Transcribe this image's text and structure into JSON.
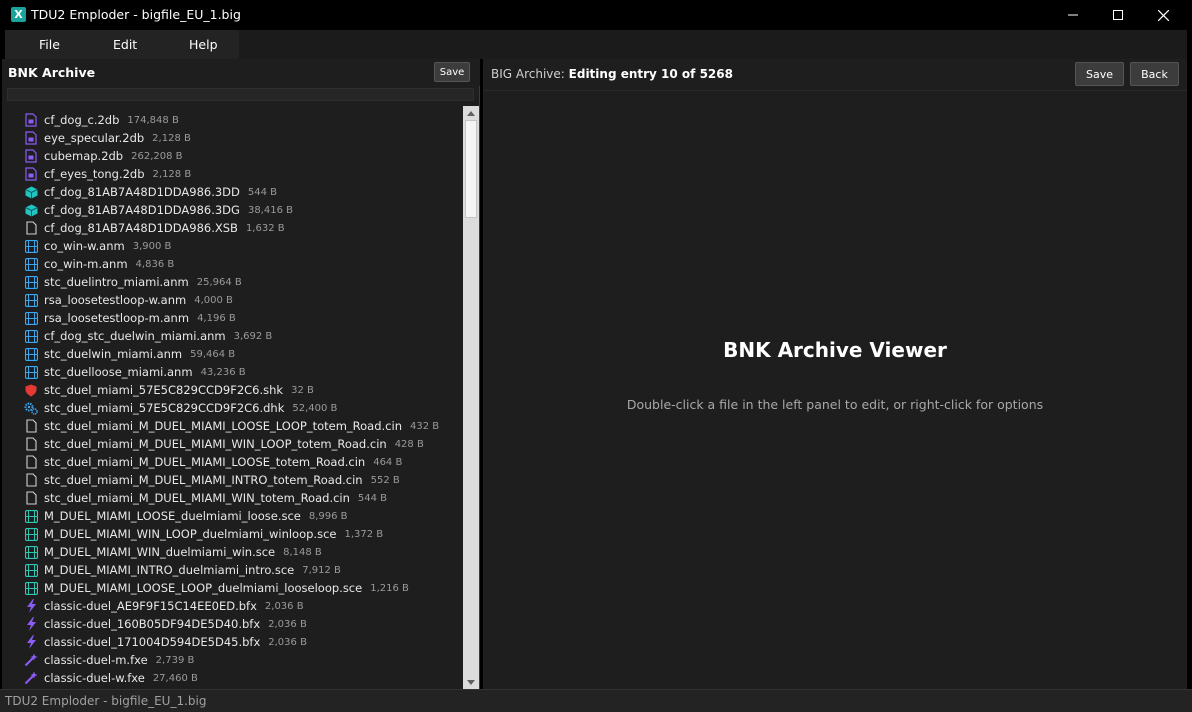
{
  "window": {
    "title": "TDU2 Emploder - bigfile_EU_1.big",
    "app_icon_letter": "X"
  },
  "menu": [
    "File",
    "Edit",
    "Help"
  ],
  "left_panel": {
    "title": "BNK Archive",
    "save_label": "Save",
    "items": [
      {
        "name": "cf_dog_c.2db",
        "size": "174,848 B",
        "icon": "file-2db-icon"
      },
      {
        "name": "eye_specular.2db",
        "size": "2,128 B",
        "icon": "file-2db-icon"
      },
      {
        "name": "cubemap.2db",
        "size": "262,208 B",
        "icon": "file-2db-icon"
      },
      {
        "name": "cf_eyes_tong.2db",
        "size": "2,128 B",
        "icon": "file-2db-icon"
      },
      {
        "name": "cf_dog_81AB7A48D1DDA986.3DD",
        "size": "544 B",
        "icon": "cube-icon"
      },
      {
        "name": "cf_dog_81AB7A48D1DDA986.3DG",
        "size": "38,416 B",
        "icon": "cube-icon"
      },
      {
        "name": "cf_dog_81AB7A48D1DDA986.XSB",
        "size": "1,632 B",
        "icon": "blank-file-icon"
      },
      {
        "name": "co_win-w.anm",
        "size": "3,900 B",
        "icon": "film-icon"
      },
      {
        "name": "co_win-m.anm",
        "size": "4,836 B",
        "icon": "film-icon"
      },
      {
        "name": "stc_duelintro_miami.anm",
        "size": "25,964 B",
        "icon": "film-icon"
      },
      {
        "name": "rsa_loosetestloop-w.anm",
        "size": "4,000 B",
        "icon": "film-icon"
      },
      {
        "name": "rsa_loosetestloop-m.anm",
        "size": "4,196 B",
        "icon": "film-icon"
      },
      {
        "name": "cf_dog_stc_duelwin_miami.anm",
        "size": "3,692 B",
        "icon": "film-icon"
      },
      {
        "name": "stc_duelwin_miami.anm",
        "size": "59,464 B",
        "icon": "film-icon"
      },
      {
        "name": "stc_duelloose_miami.anm",
        "size": "43,236 B",
        "icon": "film-icon"
      },
      {
        "name": "stc_duel_miami_57E5C829CCD9F2C6.shk",
        "size": "32 B",
        "icon": "shield-icon"
      },
      {
        "name": "stc_duel_miami_57E5C829CCD9F2C6.dhk",
        "size": "52,400 B",
        "icon": "gears-icon"
      },
      {
        "name": "stc_duel_miami_M_DUEL_MIAMI_LOOSE_LOOP_totem_Road.cin",
        "size": "432 B",
        "icon": "blank-file-icon"
      },
      {
        "name": "stc_duel_miami_M_DUEL_MIAMI_WIN_LOOP_totem_Road.cin",
        "size": "428 B",
        "icon": "blank-file-icon"
      },
      {
        "name": "stc_duel_miami_M_DUEL_MIAMI_LOOSE_totem_Road.cin",
        "size": "464 B",
        "icon": "blank-file-icon"
      },
      {
        "name": "stc_duel_miami_M_DUEL_MIAMI_INTRO_totem_Road.cin",
        "size": "552 B",
        "icon": "blank-file-icon"
      },
      {
        "name": "stc_duel_miami_M_DUEL_MIAMI_WIN_totem_Road.cin",
        "size": "544 B",
        "icon": "blank-file-icon"
      },
      {
        "name": "M_DUEL_MIAMI_LOOSE_duelmiami_loose.sce",
        "size": "8,996 B",
        "icon": "scene-icon"
      },
      {
        "name": "M_DUEL_MIAMI_WIN_LOOP_duelmiami_winloop.sce",
        "size": "1,372 B",
        "icon": "scene-icon"
      },
      {
        "name": "M_DUEL_MIAMI_WIN_duelmiami_win.sce",
        "size": "8,148 B",
        "icon": "scene-icon"
      },
      {
        "name": "M_DUEL_MIAMI_INTRO_duelmiami_intro.sce",
        "size": "7,912 B",
        "icon": "scene-icon"
      },
      {
        "name": "M_DUEL_MIAMI_LOOSE_LOOP_duelmiami_looseloop.sce",
        "size": "1,216 B",
        "icon": "scene-icon"
      },
      {
        "name": "classic-duel_AE9F9F15C14EE0ED.bfx",
        "size": "2,036 B",
        "icon": "lightning-icon"
      },
      {
        "name": "classic-duel_160B05DF94DE5D40.bfx",
        "size": "2,036 B",
        "icon": "lightning-icon"
      },
      {
        "name": "classic-duel_171004D594DE5D45.bfx",
        "size": "2,036 B",
        "icon": "lightning-icon"
      },
      {
        "name": "classic-duel-m.fxe",
        "size": "2,739 B",
        "icon": "magic-wand-icon"
      },
      {
        "name": "classic-duel-w.fxe",
        "size": "27,460 B",
        "icon": "magic-wand-icon"
      }
    ]
  },
  "right_panel": {
    "title_prefix": "BIG Archive:",
    "title_bold": "Editing entry 10 of 5268",
    "save_label": "Save",
    "back_label": "Back",
    "viewer_title": "BNK Archive Viewer",
    "viewer_subtitle": "Double-click a file in the left panel to edit, or right-click for options"
  },
  "status_bar": {
    "text": "TDU2 Emploder - bigfile_EU_1.big"
  },
  "colors": {
    "purple_icon": "#8b5cf6",
    "teal_icon": "#22c3c3",
    "film_icon": "#3ba7f0",
    "red_icon": "#e53935",
    "scene_icon": "#2fc6b5"
  }
}
